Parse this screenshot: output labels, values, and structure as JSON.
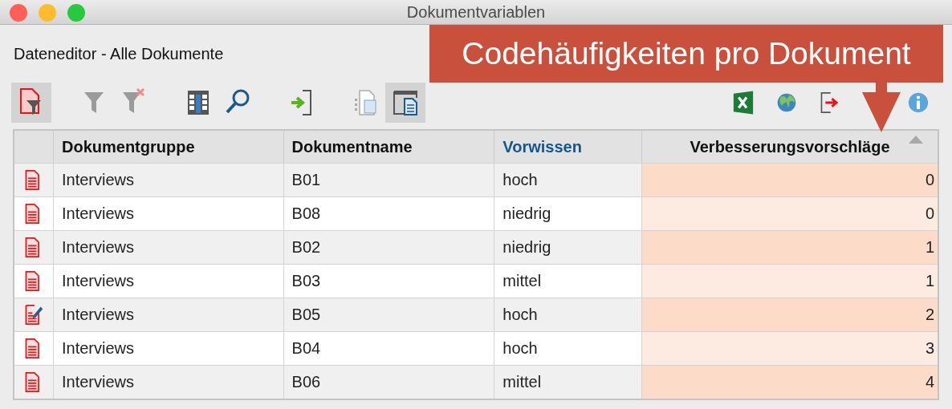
{
  "window": {
    "title": "Dokumentvariablen"
  },
  "subtitle": "Dateneditor - Alle Dokumente",
  "toolbar": {
    "left_groups": [
      [
        {
          "kind": "document-filter",
          "on": true
        }
      ],
      [
        {
          "kind": "filter",
          "on": false
        },
        {
          "kind": "filter-clear",
          "on": false
        }
      ],
      [
        {
          "kind": "columns",
          "on": false
        },
        {
          "kind": "search",
          "on": false
        }
      ],
      [
        {
          "kind": "import",
          "on": false
        }
      ],
      [
        {
          "kind": "document-list",
          "on": false
        },
        {
          "kind": "document-window",
          "on": true
        }
      ]
    ],
    "right": [
      {
        "kind": "excel"
      },
      {
        "kind": "globe"
      },
      {
        "kind": "export"
      },
      {
        "kind": "info"
      }
    ]
  },
  "callout": {
    "text": "Codehäufigkeiten pro Dokument"
  },
  "table": {
    "columns": [
      {
        "label": "Dokumentgruppe",
        "kind": "system",
        "sorted": false
      },
      {
        "label": "Dokumentname",
        "kind": "system",
        "sorted": false
      },
      {
        "label": "Vorwissen",
        "kind": "variable",
        "sorted": false
      },
      {
        "label": "Verbesserungsvorschläge",
        "kind": "code",
        "sorted": true
      }
    ],
    "rows": [
      {
        "kind": "document",
        "cells": [
          "Interviews",
          "B01",
          "hoch",
          "0"
        ]
      },
      {
        "kind": "document",
        "cells": [
          "Interviews",
          "B08",
          "niedrig",
          "0"
        ]
      },
      {
        "kind": "document",
        "cells": [
          "Interviews",
          "B02",
          "niedrig",
          "1"
        ]
      },
      {
        "kind": "document",
        "cells": [
          "Interviews",
          "B03",
          "mittel",
          "1"
        ]
      },
      {
        "kind": "memo-document",
        "cells": [
          "Interviews",
          "B05",
          "hoch",
          "2"
        ]
      },
      {
        "kind": "document",
        "cells": [
          "Interviews",
          "B04",
          "hoch",
          "3"
        ]
      },
      {
        "kind": "document",
        "cells": [
          "Interviews",
          "B06",
          "mittel",
          "4"
        ]
      }
    ]
  }
}
